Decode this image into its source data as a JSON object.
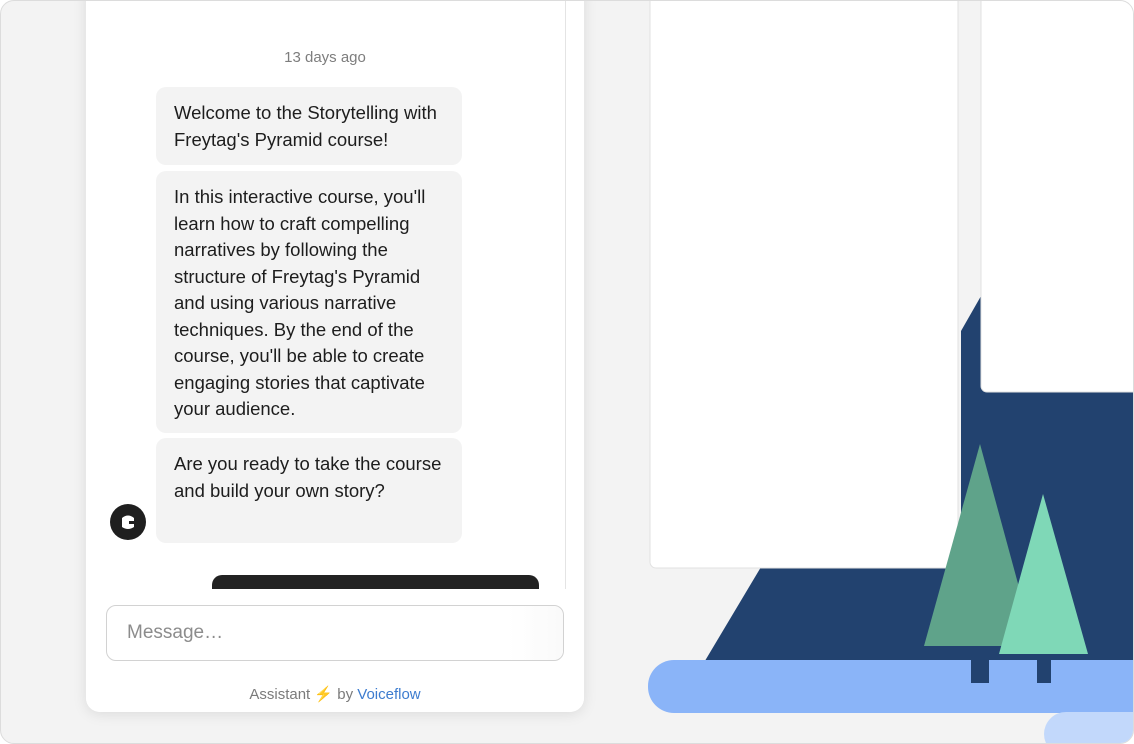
{
  "chat": {
    "timestamp": "13 days ago",
    "messages": [
      {
        "text": "Welcome to the Storytelling with Freytag's Pyramid course!"
      },
      {
        "text": "In this interactive course, you'll learn how to craft compelling narratives by following the structure of Freytag's Pyramid and using various narrative techniques. By the end of the course, you'll be able to create engaging stories that captivate your audience."
      },
      {
        "text": "Are you ready to take the course and build your own story?"
      }
    ],
    "avatar_icon": "assistant-avatar-icon"
  },
  "composer": {
    "placeholder": "Message…"
  },
  "footer": {
    "prefix": "Assistant",
    "bolt": "⚡",
    "by": "by",
    "brand": "Voiceflow"
  },
  "colors": {
    "background": "#f3f3f3",
    "bubble": "#f3f3f3",
    "navy": "#22426f",
    "tree_dark": "#5fa38a",
    "tree_light": "#7fd8b7",
    "ground": "#8ab4f8",
    "link": "#3d7ccf"
  }
}
